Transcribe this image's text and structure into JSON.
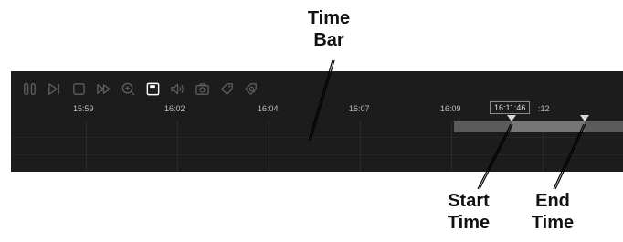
{
  "callouts": {
    "time_bar": [
      "Time",
      "Bar"
    ],
    "start_time": [
      "Start",
      "Time"
    ],
    "end_time": [
      "End",
      "Time"
    ]
  },
  "toolbar": {
    "buttons": [
      {
        "icon": "pause-icon"
      },
      {
        "icon": "step-forward-icon"
      },
      {
        "icon": "stop-icon"
      },
      {
        "icon": "fast-forward-icon"
      },
      {
        "icon": "zoom-in-icon"
      },
      {
        "icon": "save-icon"
      },
      {
        "icon": "volume-icon"
      },
      {
        "icon": "camera-icon"
      },
      {
        "icon": "tag-icon"
      },
      {
        "icon": "tag-search-icon"
      }
    ]
  },
  "timeline": {
    "tick_labels": [
      "15:59",
      "16:02",
      "16:04",
      "16:07",
      "16:09",
      ":12"
    ],
    "current_time": "16:11:46"
  },
  "colors": {
    "panel_bg": "#1c1c1c",
    "range_bar": "#5b5b5b",
    "range_selected": "#767676",
    "marker": "#d8d8d8",
    "highlighted_icon": "#ffffff",
    "icon": "#5f5f5f"
  }
}
